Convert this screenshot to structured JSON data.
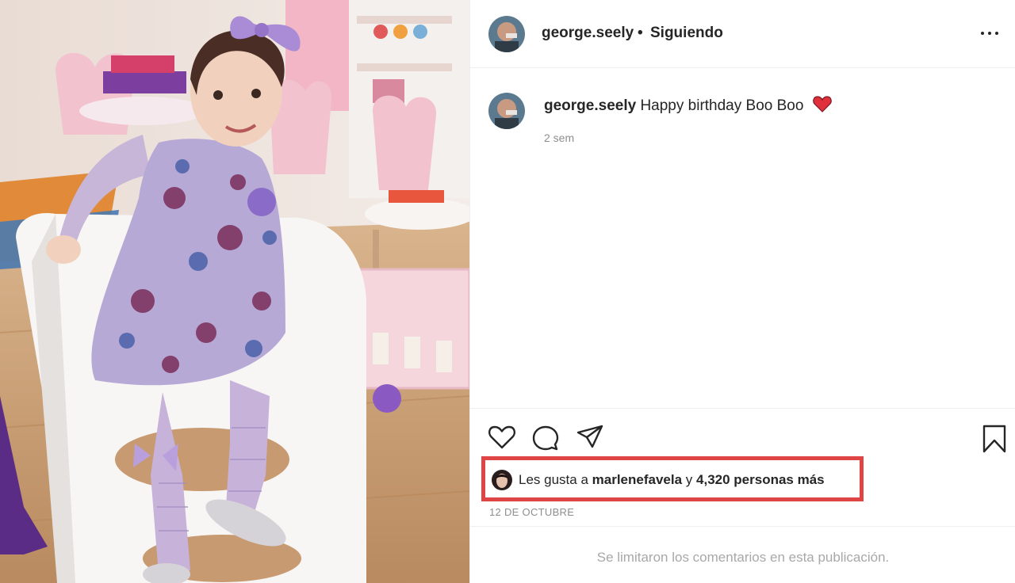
{
  "post": {
    "image_alt": "Niña pequeña con vestido floral lila sentada en un banco blanco en una sala de juegos rosa"
  },
  "header": {
    "username": "george.seely",
    "separator": "•",
    "follow_status": "Siguiendo"
  },
  "caption": {
    "username": "george.seely",
    "text": "Happy birthday Boo Boo",
    "emoji": "red-heart-icon",
    "time_ago": "2 sem"
  },
  "actions": {
    "like": "heart-icon",
    "comment": "comment-icon",
    "share": "paper-plane-icon",
    "save": "bookmark-icon"
  },
  "likes": {
    "prefix": "Les gusta a",
    "user": "marlenefavela",
    "conjunction": "y",
    "others": "4,320 personas más",
    "highlight_color": "#e04545"
  },
  "date": "12 DE OCTUBRE",
  "comments_notice": "Se limitaron los comentarios en esta publicación.",
  "colors": {
    "text": "#262626",
    "secondary": "#8e8e8e",
    "border": "#efefef"
  }
}
